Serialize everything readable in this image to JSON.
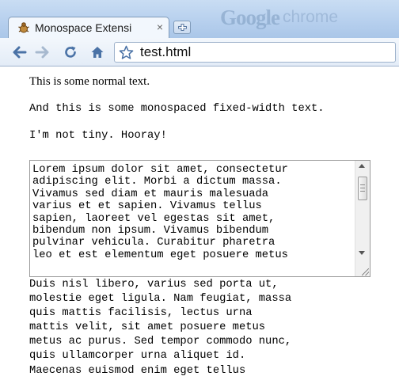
{
  "browser": {
    "brand_google": "Google",
    "brand_chrome": "chrome",
    "tab": {
      "title": "Monospace Extensi",
      "close_label": "×",
      "favicon": "puzzle-bug-icon"
    },
    "new_tab_icon": "new-tab-plus-icon",
    "toolbar": {
      "back_icon": "back-arrow-icon",
      "forward_icon": "forward-arrow-icon",
      "reload_icon": "reload-icon",
      "home_icon": "home-icon",
      "star_icon": "star-icon"
    },
    "url": "test.html",
    "colors": {
      "frame": "#b7d0ee",
      "accent_blue": "#4a72a6"
    }
  },
  "page": {
    "normal_text": "This is some normal text.",
    "mono_text": "And this is some monospaced fixed-width text.",
    "not_tiny_text": "I'm not tiny. Hooray!",
    "textarea": {
      "text": "Lorem ipsum dolor sit amet, consectetur\nadipiscing elit. Morbi a dictum massa.\nVivamus sed diam et mauris malesuada\nvarius et et sapien. Vivamus tellus\nsapien, laoreet vel egestas sit amet,\nbibendum non ipsum. Vivamus bibendum\npulvinar vehicula. Curabitur pharetra\nleo et est elementum eget posuere metus"
    },
    "overflow_text": "Duis nisl libero, varius sed porta ut,\nmolestie eget ligula. Nam feugiat, massa\nquis mattis facilisis, lectus urna\nmattis velit, sit amet posuere metus\nmetus ac purus. Sed tempor commodo nunc,\nquis ullamcorper urna aliquet id.\nMaecenas euismod enim eget tellus"
  }
}
